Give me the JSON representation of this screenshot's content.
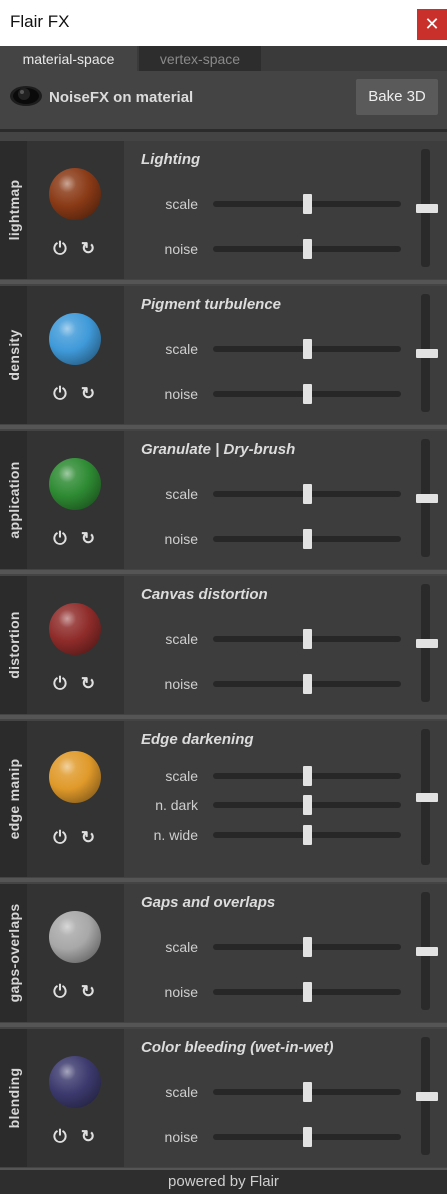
{
  "window": {
    "title": "Flair FX",
    "close_glyph": "✕"
  },
  "tabs": [
    {
      "label": "material-space",
      "active": true
    },
    {
      "label": "vertex-space",
      "active": false
    }
  ],
  "toolbar": {
    "eye_icon": "eye-icon",
    "label": "NoiseFX on material",
    "bake_label": "Bake 3D"
  },
  "controls": {
    "power_glyph": "⏻",
    "reset_glyph": "↻"
  },
  "panels": [
    {
      "tab": "lightmap",
      "title": "Lighting",
      "sphere_color": "#8a3a16",
      "rows": [
        {
          "label": "scale",
          "value": 0.5
        },
        {
          "label": "noise",
          "value": 0.5
        }
      ],
      "intensity": 0.5
    },
    {
      "tab": "density",
      "title": "Pigment turbulence",
      "sphere_color": "#3f9ad9",
      "rows": [
        {
          "label": "scale",
          "value": 0.5
        },
        {
          "label": "noise",
          "value": 0.5
        }
      ],
      "intensity": 0.5
    },
    {
      "tab": "application",
      "title": "Granulate | Dry-brush",
      "sphere_color": "#2e8b33",
      "rows": [
        {
          "label": "scale",
          "value": 0.5
        },
        {
          "label": "noise",
          "value": 0.5
        }
      ],
      "intensity": 0.5
    },
    {
      "tab": "distortion",
      "title": "Canvas distortion",
      "sphere_color": "#8f2c2a",
      "rows": [
        {
          "label": "scale",
          "value": 0.5
        },
        {
          "label": "noise",
          "value": 0.5
        }
      ],
      "intensity": 0.5
    },
    {
      "tab": "edge manip",
      "title": "Edge darkening",
      "sphere_color": "#e09a2a",
      "rows": [
        {
          "label": "scale",
          "value": 0.5
        },
        {
          "label": "n. dark",
          "value": 0.5
        },
        {
          "label": "n. wide",
          "value": 0.5
        }
      ],
      "intensity": 0.5
    },
    {
      "tab": "gaps-overlaps",
      "title": "Gaps and overlaps",
      "sphere_color": "#a8a8a8",
      "rows": [
        {
          "label": "scale",
          "value": 0.5
        },
        {
          "label": "noise",
          "value": 0.5
        }
      ],
      "intensity": 0.5
    },
    {
      "tab": "blending",
      "title": "Color bleeding (wet-in-wet)",
      "sphere_color": "#3c3a6e",
      "rows": [
        {
          "label": "scale",
          "value": 0.5
        },
        {
          "label": "noise",
          "value": 0.5
        }
      ],
      "intensity": 0.5
    }
  ],
  "footer": {
    "label": "powered by Flair"
  }
}
